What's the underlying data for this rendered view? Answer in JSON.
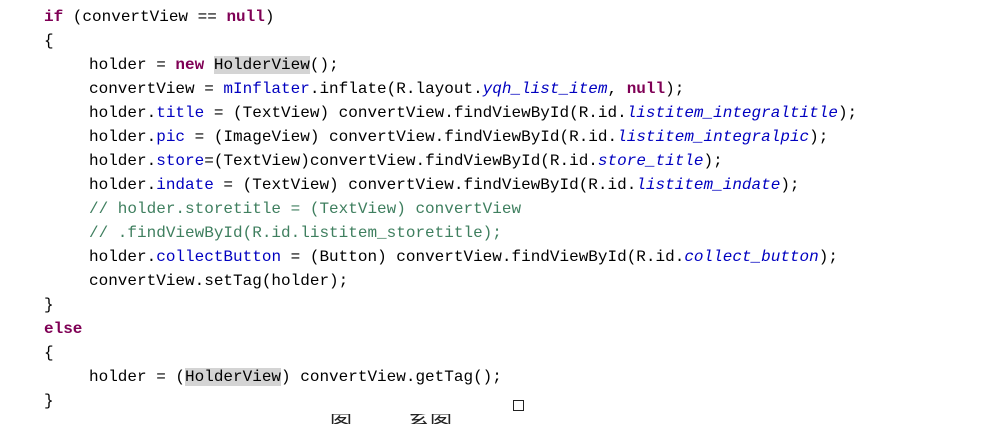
{
  "code_lines": [
    [
      {
        "t": "if",
        "c": "kw"
      },
      {
        "t": " (convertView == ",
        "c": "plain"
      },
      {
        "t": "null",
        "c": "kw"
      },
      {
        "t": ")",
        "c": "plain"
      }
    ],
    [
      {
        "t": "{",
        "c": "plain"
      }
    ],
    [
      {
        "t": "holder = ",
        "c": "plain"
      },
      {
        "t": "new",
        "c": "kw"
      },
      {
        "t": " ",
        "c": "plain"
      },
      {
        "t": "HolderView",
        "c": "hl"
      },
      {
        "t": "();",
        "c": "plain"
      }
    ],
    [
      {
        "t": "convertView = ",
        "c": "plain"
      },
      {
        "t": "mInflater",
        "c": "fld"
      },
      {
        "t": ".inflate(R.layout.",
        "c": "plain"
      },
      {
        "t": "yqh_list_item",
        "c": "sfld"
      },
      {
        "t": ", ",
        "c": "plain"
      },
      {
        "t": "null",
        "c": "kw"
      },
      {
        "t": ");",
        "c": "plain"
      }
    ],
    [
      {
        "t": "holder.",
        "c": "plain"
      },
      {
        "t": "title",
        "c": "fld"
      },
      {
        "t": " = (TextView) convertView.findViewById(R.id.",
        "c": "plain"
      },
      {
        "t": "listitem_integraltitle",
        "c": "sfld"
      },
      {
        "t": ");",
        "c": "plain"
      }
    ],
    [
      {
        "t": "holder.",
        "c": "plain"
      },
      {
        "t": "pic",
        "c": "fld"
      },
      {
        "t": " = (ImageView) convertView.findViewById(R.id.",
        "c": "plain"
      },
      {
        "t": "listitem_integralpic",
        "c": "sfld"
      },
      {
        "t": ");",
        "c": "plain"
      }
    ],
    [
      {
        "t": "holder.",
        "c": "plain"
      },
      {
        "t": "store",
        "c": "fld"
      },
      {
        "t": "=(TextView)convertView.findViewById(R.id.",
        "c": "plain"
      },
      {
        "t": "store_title",
        "c": "sfld"
      },
      {
        "t": ");",
        "c": "plain"
      }
    ],
    [
      {
        "t": "holder.",
        "c": "plain"
      },
      {
        "t": "indate",
        "c": "fld"
      },
      {
        "t": " = (TextView) convertView.findViewById(R.id.",
        "c": "plain"
      },
      {
        "t": "listitem_indate",
        "c": "sfld"
      },
      {
        "t": ");",
        "c": "plain"
      }
    ],
    [
      {
        "t": "// holder.storetitle = (TextView) convertView",
        "c": "cmt"
      }
    ],
    [
      {
        "t": "// .findViewById(R.id.listitem_storetitle);",
        "c": "cmt"
      }
    ],
    [
      {
        "t": "holder.",
        "c": "plain"
      },
      {
        "t": "collectButton",
        "c": "fld"
      },
      {
        "t": " = (Button) convertView.findViewById(R.id.",
        "c": "plain"
      },
      {
        "t": "collect_button",
        "c": "sfld"
      },
      {
        "t": ");",
        "c": "plain"
      }
    ],
    [
      {
        "t": "convertView.setTag(holder);",
        "c": "plain"
      }
    ],
    [
      {
        "t": "}",
        "c": "plain"
      }
    ],
    [
      {
        "t": "else",
        "c": "kw"
      }
    ],
    [
      {
        "t": "{",
        "c": "plain"
      }
    ],
    [
      {
        "t": "holder = (",
        "c": "plain"
      },
      {
        "t": "HolderView",
        "c": "hl"
      },
      {
        "t": ") convertView.getTag();",
        "c": "plain"
      }
    ],
    [
      {
        "t": "}",
        "c": "plain"
      }
    ]
  ],
  "cutoff_caption": "图        系图"
}
